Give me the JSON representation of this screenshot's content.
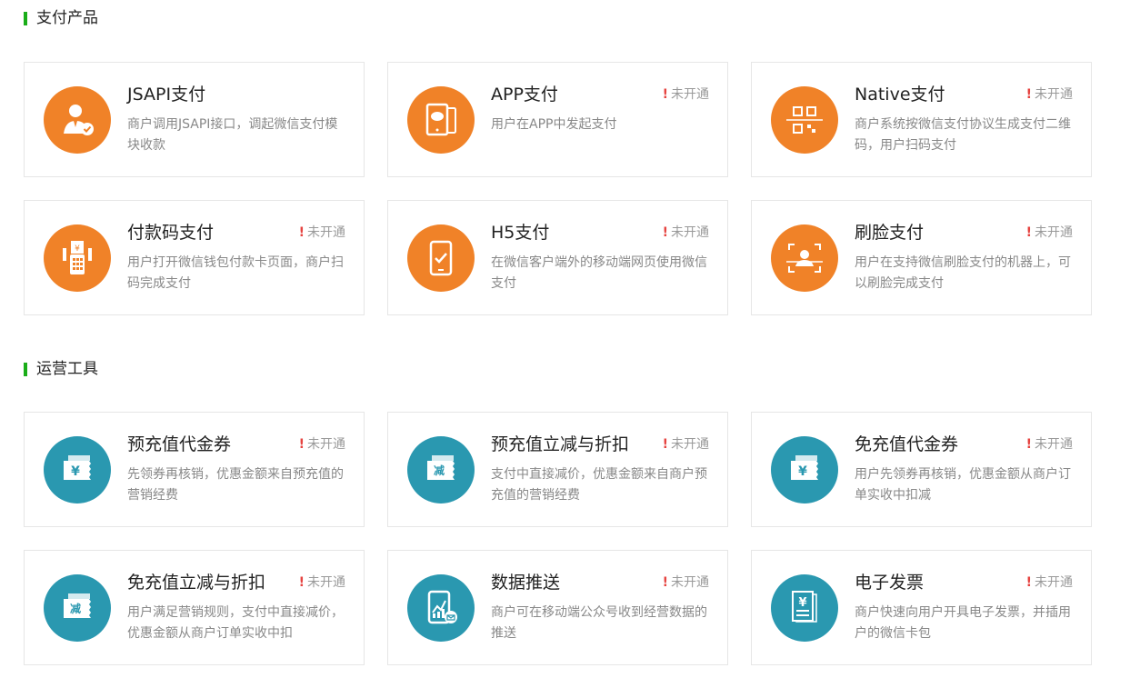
{
  "colors": {
    "accent_green": "#1aad19",
    "orange": "#f08228",
    "teal": "#2a98b0",
    "alert_red": "#e64340"
  },
  "sections": [
    {
      "title": "支付产品",
      "cards": [
        {
          "name": "JSAPI支付",
          "status": "",
          "desc": "商户调用JSAPI接口，调起微信支付模块收款",
          "icon": "person-check-icon"
        },
        {
          "name": "APP支付",
          "status": "未开通",
          "desc": "用户在APP中发起支付",
          "icon": "mobile-app-icon"
        },
        {
          "name": "Native支付",
          "status": "未开通",
          "desc": "商户系统按微信支付协议生成支付二维码，用户扫码支付",
          "icon": "qr-code-icon"
        },
        {
          "name": "付款码支付",
          "status": "未开通",
          "desc": "用户打开微信钱包付款卡页面，商户扫码完成支付",
          "icon": "pos-terminal-icon"
        },
        {
          "name": "H5支付",
          "status": "未开通",
          "desc": "在微信客户端外的移动端网页使用微信支付",
          "icon": "phone-check-icon"
        },
        {
          "name": "刷脸支付",
          "status": "未开通",
          "desc": "用户在支持微信刷脸支付的机器上，可以刷脸完成支付",
          "icon": "face-scan-icon"
        }
      ]
    },
    {
      "title": "运营工具",
      "cards": [
        {
          "name": "预充值代金券",
          "status": "未开通",
          "desc": "先领券再核销，优惠金额来自预充值的营销经费",
          "icon": "yuan-voucher-icon",
          "glyph": "¥"
        },
        {
          "name": "预充值立减与折扣",
          "status": "未开通",
          "desc": "支付中直接减价，优惠金额来自商户预充值的营销经费",
          "icon": "discount-voucher-icon",
          "glyph": "减"
        },
        {
          "name": "免充值代金券",
          "status": "未开通",
          "desc": "用户先领券再核销，优惠金额从商户订单实收中扣减",
          "icon": "yuan-voucher-icon",
          "glyph": "¥"
        },
        {
          "name": "免充值立减与折扣",
          "status": "未开通",
          "desc": "用户满足营销规则，支付中直接减价，优惠金额从商户订单实收中扣",
          "icon": "discount-voucher-icon",
          "glyph": "减"
        },
        {
          "name": "数据推送",
          "status": "未开通",
          "desc": "商户可在移动端公众号收到经营数据的推送",
          "icon": "data-push-icon"
        },
        {
          "name": "电子发票",
          "status": "未开通",
          "desc": "商户快速向用户开具电子发票，并插用户的微信卡包",
          "icon": "invoice-icon",
          "glyph": "¥"
        }
      ]
    }
  ]
}
